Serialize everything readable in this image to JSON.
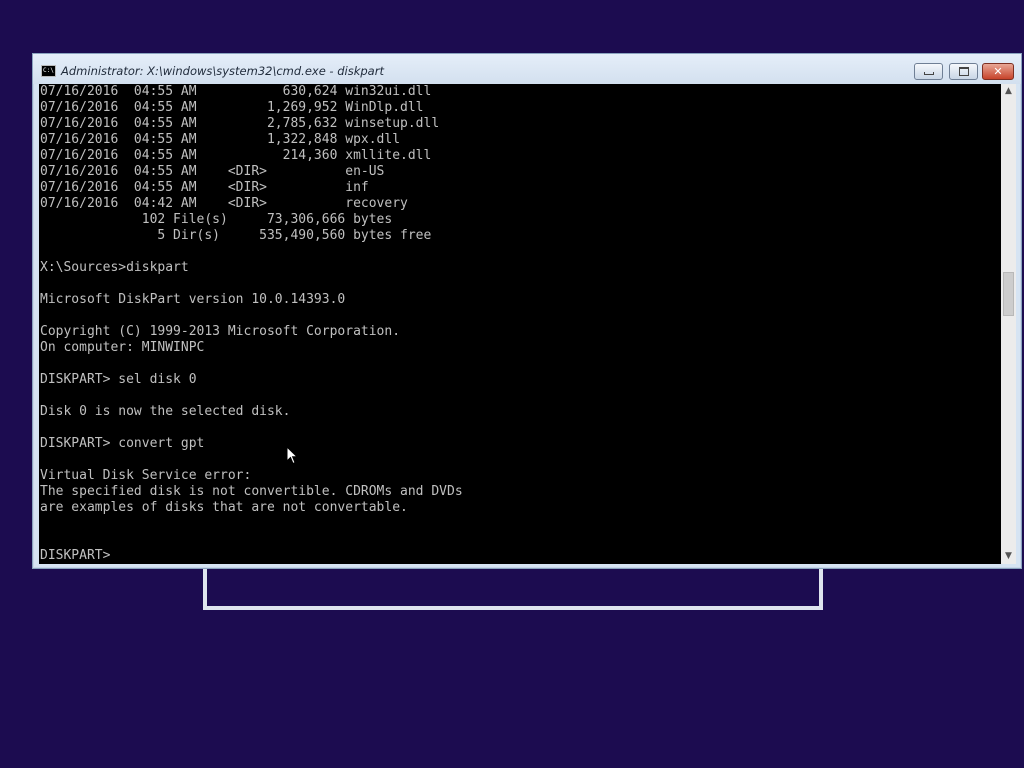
{
  "window": {
    "title": "Administrator: X:\\windows\\system32\\cmd.exe - diskpart",
    "app_icon_text": "C:\\",
    "controls": {
      "minimize": "minimize-icon",
      "maximize": "maximize-icon",
      "close": "close-icon",
      "close_glyph": "✕"
    }
  },
  "console": {
    "lines": [
      "07/16/2016  04:55 AM           630,624 win32ui.dll",
      "07/16/2016  04:55 AM         1,269,952 WinDlp.dll",
      "07/16/2016  04:55 AM         2,785,632 winsetup.dll",
      "07/16/2016  04:55 AM         1,322,848 wpx.dll",
      "07/16/2016  04:55 AM           214,360 xmllite.dll",
      "07/16/2016  04:55 AM    <DIR>          en-US",
      "07/16/2016  04:55 AM    <DIR>          inf",
      "07/16/2016  04:42 AM    <DIR>          recovery",
      "             102 File(s)     73,306,666 bytes",
      "               5 Dir(s)     535,490,560 bytes free",
      "",
      "X:\\Sources>diskpart",
      "",
      "Microsoft DiskPart version 10.0.14393.0",
      "",
      "Copyright (C) 1999-2013 Microsoft Corporation.",
      "On computer: MINWINPC",
      "",
      "DISKPART> sel disk 0",
      "",
      "Disk 0 is now the selected disk.",
      "",
      "DISKPART> convert gpt",
      "",
      "Virtual Disk Service error:",
      "The specified disk is not convertible. CDROMs and DVDs",
      "are examples of disks that are not convertable.",
      "",
      "",
      "DISKPART> "
    ]
  },
  "scrollbar": {
    "up_arrow": "▲",
    "down_arrow": "▼"
  },
  "colors": {
    "desktop_background": "#1c0c50",
    "console_background": "#000000",
    "console_text": "#c0c0c0",
    "window_frame": "#d6e4f3",
    "close_button": "#c7432a"
  }
}
